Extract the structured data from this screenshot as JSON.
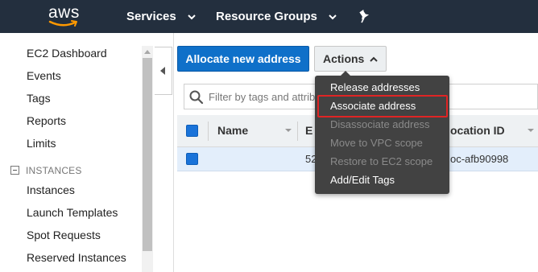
{
  "topbar": {
    "logo_text": "aws",
    "services_label": "Services",
    "resource_groups_label": "Resource Groups",
    "pin_icon": "pin-icon"
  },
  "sidebar": {
    "items": [
      {
        "label": "EC2 Dashboard"
      },
      {
        "label": "Events"
      },
      {
        "label": "Tags"
      },
      {
        "label": "Reports"
      },
      {
        "label": "Limits"
      }
    ],
    "section": {
      "label": "INSTANCES",
      "items": [
        {
          "label": "Instances"
        },
        {
          "label": "Launch Templates"
        },
        {
          "label": "Spot Requests"
        },
        {
          "label": "Reserved Instances"
        }
      ]
    }
  },
  "toolbar": {
    "allocate_label": "Allocate new address",
    "actions_label": "Actions"
  },
  "search": {
    "placeholder": "Filter by tags and attributes"
  },
  "table": {
    "headers": {
      "name": "Name",
      "elastic_ip": "E",
      "association_id": "ocation ID"
    },
    "rows": [
      {
        "name": "",
        "elastic_ip": "52",
        "association_id": "oc-afb90998"
      }
    ]
  },
  "actions_menu": {
    "items": [
      {
        "label": "Release addresses",
        "enabled": true
      },
      {
        "label": "Associate address",
        "enabled": true,
        "highlighted": true
      },
      {
        "label": "Disassociate address",
        "enabled": false
      },
      {
        "label": "Move to VPC scope",
        "enabled": false
      },
      {
        "label": "Restore to EC2 scope",
        "enabled": false
      },
      {
        "label": "Add/Edit Tags",
        "enabled": true
      }
    ]
  },
  "colors": {
    "topbar_bg": "#232f3e",
    "primary_button": "#0f70c9",
    "menu_bg": "#424242",
    "highlight_border": "#e02424",
    "selected_row": "#e3eefb"
  }
}
